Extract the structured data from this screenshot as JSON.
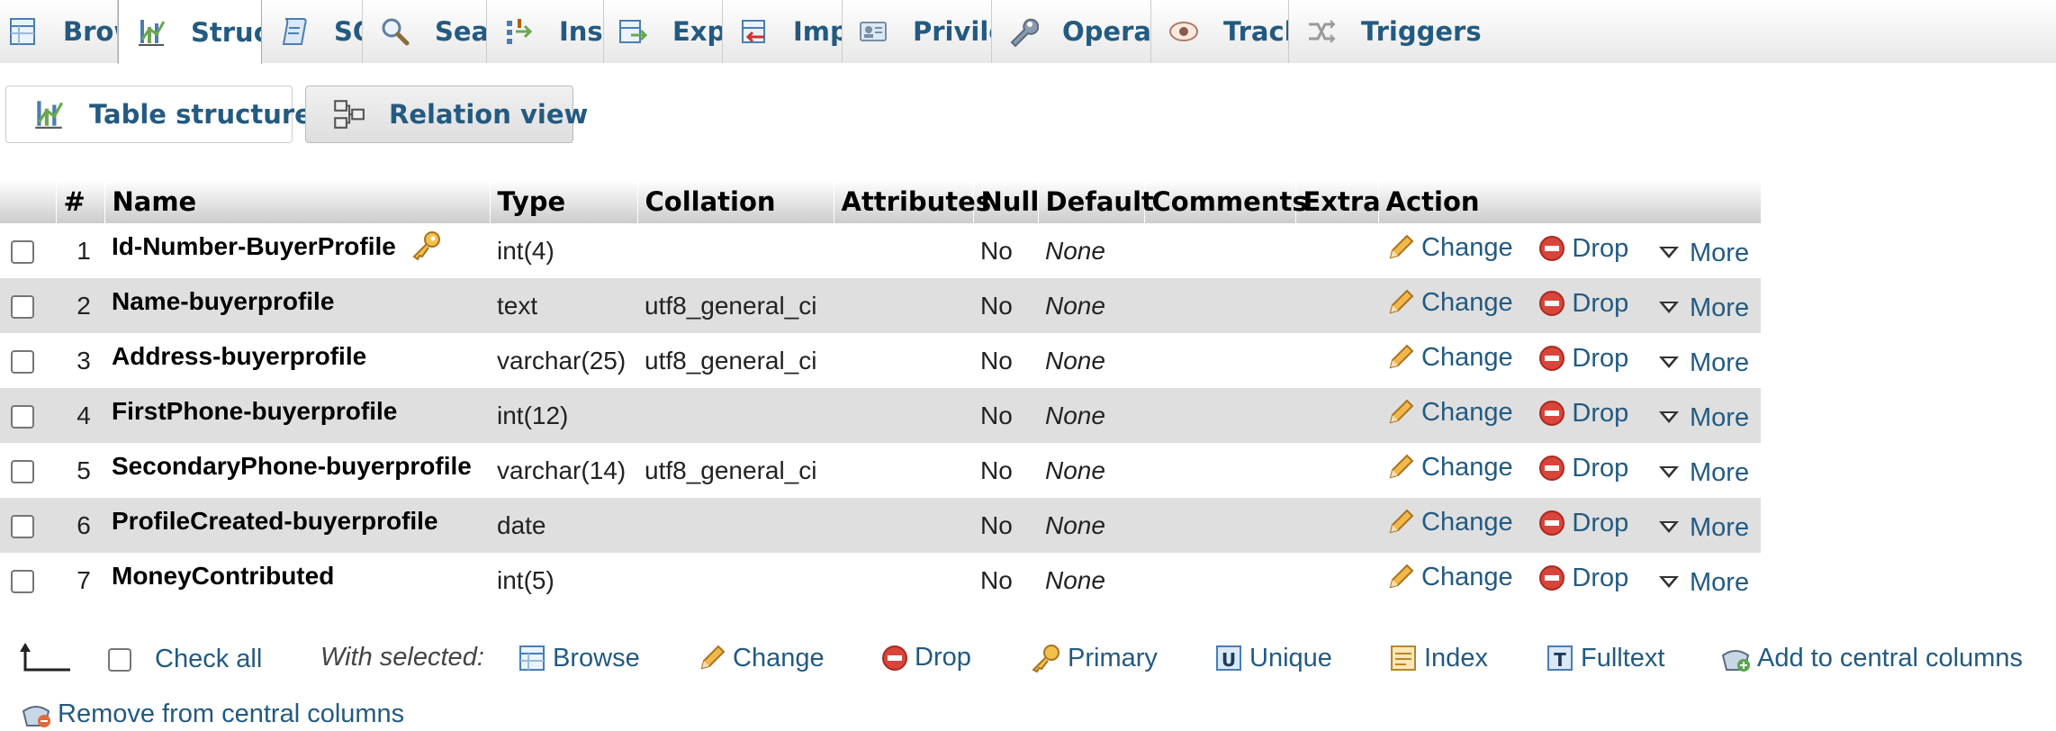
{
  "tabs": [
    {
      "label": "Browse",
      "icon": "browse-icon",
      "active": false
    },
    {
      "label": "Structure",
      "icon": "structure-icon",
      "active": true
    },
    {
      "label": "SQL",
      "icon": "sql-icon",
      "active": false
    },
    {
      "label": "Search",
      "icon": "search-icon",
      "active": false
    },
    {
      "label": "Insert",
      "icon": "insert-icon",
      "active": false
    },
    {
      "label": "Export",
      "icon": "export-icon",
      "active": false
    },
    {
      "label": "Import",
      "icon": "import-icon",
      "active": false
    },
    {
      "label": "Privileges",
      "icon": "privileges-icon",
      "active": false
    },
    {
      "label": "Operations",
      "icon": "wrench-icon",
      "active": false
    },
    {
      "label": "Tracking",
      "icon": "eye-icon",
      "active": false
    },
    {
      "label": "Triggers",
      "icon": "triggers-icon",
      "active": false
    }
  ],
  "subtabs": [
    {
      "label": "Table structure",
      "icon": "structure-icon"
    },
    {
      "label": "Relation view",
      "icon": "relation-icon"
    }
  ],
  "columns": [
    "#",
    "Name",
    "Type",
    "Collation",
    "Attributes",
    "Null",
    "Default",
    "Comments",
    "Extra",
    "Action"
  ],
  "rows": [
    {
      "num": "1",
      "name": "Id-Number-BuyerProfile",
      "primary_key": true,
      "type": "int(4)",
      "collation": "",
      "attributes": "",
      "null": "No",
      "default": "None",
      "comments": "",
      "extra": ""
    },
    {
      "num": "2",
      "name": "Name-buyerprofile",
      "primary_key": false,
      "type": "text",
      "collation": "utf8_general_ci",
      "attributes": "",
      "null": "No",
      "default": "None",
      "comments": "",
      "extra": ""
    },
    {
      "num": "3",
      "name": "Address-buyerprofile",
      "primary_key": false,
      "type": "varchar(25)",
      "collation": "utf8_general_ci",
      "attributes": "",
      "null": "No",
      "default": "None",
      "comments": "",
      "extra": ""
    },
    {
      "num": "4",
      "name": "FirstPhone-buyerprofile",
      "primary_key": false,
      "type": "int(12)",
      "collation": "",
      "attributes": "",
      "null": "No",
      "default": "None",
      "comments": "",
      "extra": ""
    },
    {
      "num": "5",
      "name": "SecondaryPhone-buyerprofile",
      "primary_key": false,
      "type": "varchar(14)",
      "collation": "utf8_general_ci",
      "attributes": "",
      "null": "No",
      "default": "None",
      "comments": "",
      "extra": ""
    },
    {
      "num": "6",
      "name": "ProfileCreated-buyerprofile",
      "primary_key": false,
      "type": "date",
      "collation": "",
      "attributes": "",
      "null": "No",
      "default": "None",
      "comments": "",
      "extra": ""
    },
    {
      "num": "7",
      "name": "MoneyContributed",
      "primary_key": false,
      "type": "int(5)",
      "collation": "",
      "attributes": "",
      "null": "No",
      "default": "None",
      "comments": "",
      "extra": ""
    }
  ],
  "row_actions": {
    "change": "Change",
    "drop": "Drop",
    "more": "More"
  },
  "footer": {
    "check_all": "Check all",
    "with_selected": "With selected:",
    "browse": "Browse",
    "change": "Change",
    "drop": "Drop",
    "primary": "Primary",
    "unique": "Unique",
    "index": "Index",
    "fulltext": "Fulltext",
    "add_central": "Add to central columns",
    "remove_central": "Remove from central columns"
  },
  "colors": {
    "link": "#235a81",
    "row_alt": "#dfdfdf",
    "drop_red": "#d9453a",
    "pencil": "#e8a33a"
  }
}
